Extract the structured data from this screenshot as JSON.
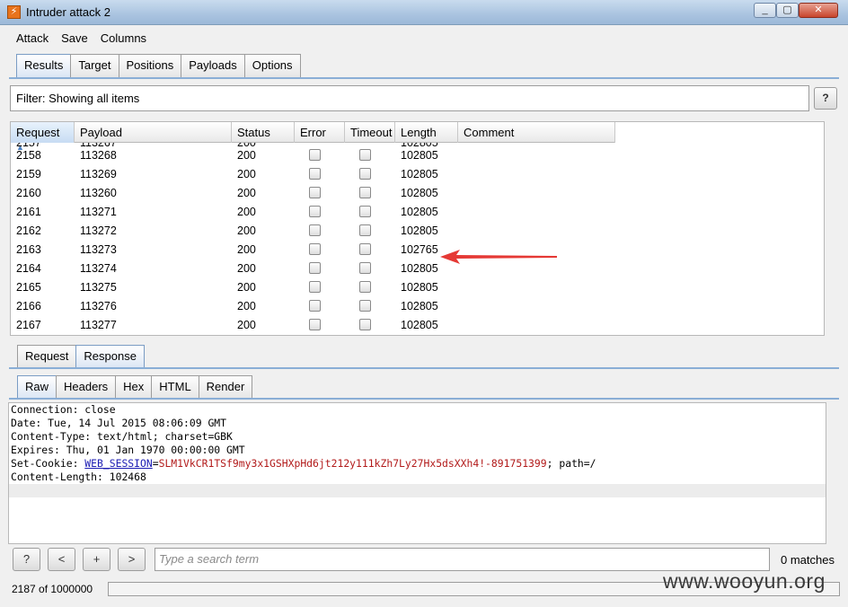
{
  "window": {
    "title": "Intruder attack 2",
    "min": "_",
    "max": "▢",
    "close": "✕"
  },
  "menu": [
    "Attack",
    "Save",
    "Columns"
  ],
  "main_tabs": [
    "Results",
    "Target",
    "Positions",
    "Payloads",
    "Options"
  ],
  "filter": {
    "text": "Filter: Showing all items",
    "help": "?"
  },
  "table": {
    "columns": [
      "Request",
      "Payload",
      "Status",
      "Error",
      "Timeout",
      "Length",
      "Comment"
    ],
    "sort_indicator": "▲",
    "partial_top": {
      "request": "2157",
      "payload": "113267",
      "status": "200",
      "length": "102805"
    },
    "rows": [
      {
        "request": "2158",
        "payload": "113268",
        "status": "200",
        "length": "102805"
      },
      {
        "request": "2159",
        "payload": "113269",
        "status": "200",
        "length": "102805"
      },
      {
        "request": "2160",
        "payload": "113260",
        "status": "200",
        "length": "102805"
      },
      {
        "request": "2161",
        "payload": "113271",
        "status": "200",
        "length": "102805"
      },
      {
        "request": "2162",
        "payload": "113272",
        "status": "200",
        "length": "102805"
      },
      {
        "request": "2163",
        "payload": "113273",
        "status": "200",
        "length": "102765"
      },
      {
        "request": "2164",
        "payload": "113274",
        "status": "200",
        "length": "102805"
      },
      {
        "request": "2165",
        "payload": "113275",
        "status": "200",
        "length": "102805"
      },
      {
        "request": "2166",
        "payload": "113276",
        "status": "200",
        "length": "102805"
      },
      {
        "request": "2167",
        "payload": "113277",
        "status": "200",
        "length": "102805"
      }
    ]
  },
  "req_resp_tabs": [
    "Request",
    "Response"
  ],
  "view_tabs": [
    "Raw",
    "Headers",
    "Hex",
    "HTML",
    "Render"
  ],
  "raw_lines": {
    "l1": "Connection: close",
    "l2": "Date: Tue, 14 Jul 2015 08:06:09 GMT",
    "l3": "Content-Type: text/html; charset=GBK",
    "l4": "Expires: Thu, 01 Jan 1970 00:00:00 GMT",
    "l5_prefix": "Set-Cookie: ",
    "l5_key": "WEB_SESSION",
    "l5_eq": "=",
    "l5_val": "SLM1VkCR1TSf9my3x1GSHXpHd6jt212y111kZh7Ly27Hx5dsXXh4!-891751399",
    "l5_suffix": "; path=/",
    "l6": "Content-Length: 102468"
  },
  "search": {
    "placeholder": "Type a search term",
    "matches": "0 matches",
    "btn_help": "?",
    "btn_prev": "<",
    "btn_add": "+",
    "btn_next": ">"
  },
  "status": {
    "progress_text": "2187 of 1000000",
    "watermark": "www.wooyun.org"
  },
  "colors": {
    "arrow": "#e53935",
    "cookie_key": "#1b1bb3",
    "cookie_val": "#b21a1a"
  }
}
